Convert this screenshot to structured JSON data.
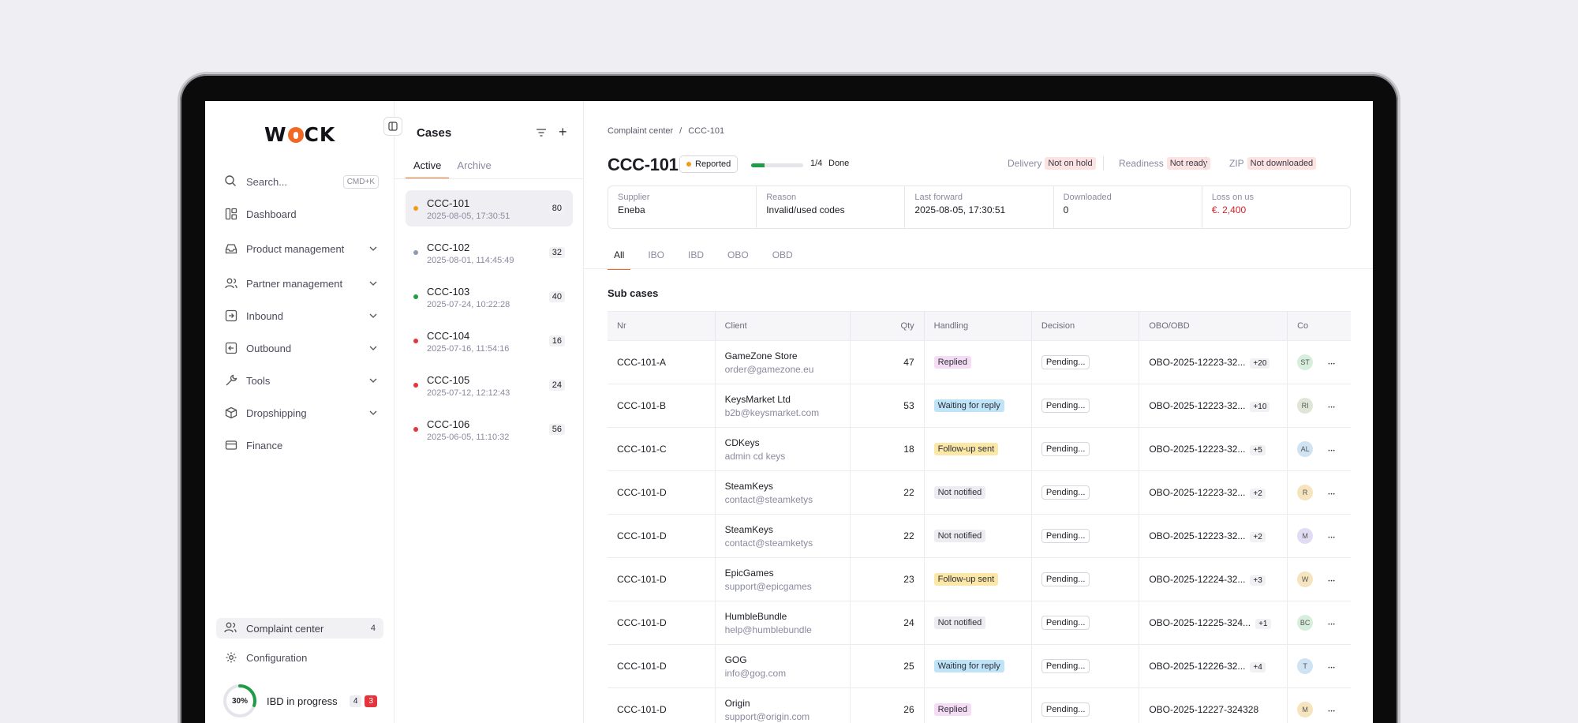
{
  "app": {
    "logo_left": "W",
    "logo_right": "CK"
  },
  "sidebar": {
    "search_label": "Search...",
    "search_shortcut": "CMD+K",
    "items": [
      {
        "label": "Dashboard",
        "icon": "dashboard-icon"
      },
      {
        "label": "Product management",
        "icon": "inbox-icon"
      },
      {
        "label": "Partner management",
        "icon": "users-icon"
      },
      {
        "label": "Inbound",
        "icon": "arrow-in-icon"
      },
      {
        "label": "Outbound",
        "icon": "arrow-out-icon"
      },
      {
        "label": "Tools",
        "icon": "wrench-icon"
      },
      {
        "label": "Dropshipping",
        "icon": "box-icon"
      },
      {
        "label": "Finance",
        "icon": "card-icon"
      }
    ],
    "complaint_center": {
      "label": "Complaint center",
      "count": "4"
    },
    "configuration": {
      "label": "Configuration"
    },
    "progress": {
      "percent_label": "30%",
      "percent": 0.3,
      "label": "IBD in progress",
      "count": "4",
      "alerts": "3"
    }
  },
  "cases": {
    "title": "Cases",
    "tabs": [
      "Active",
      "Archive"
    ],
    "items": [
      {
        "id": "CCC-101",
        "date": "2025-08-05, 17:30:51",
        "count": "80",
        "color": "#f29a1a"
      },
      {
        "id": "CCC-102",
        "date": "2025-08-01, 114:45:49",
        "count": "32",
        "color": "#8c9bb0"
      },
      {
        "id": "CCC-103",
        "date": "2025-07-24, 10:22:28",
        "count": "40",
        "color": "#1f9d46"
      },
      {
        "id": "CCC-104",
        "date": "2025-07-16, 11:54:16",
        "count": "16",
        "color": "#e5343b"
      },
      {
        "id": "CCC-105",
        "date": "2025-07-12, 12:12:43",
        "count": "24",
        "color": "#e5343b"
      },
      {
        "id": "CCC-106",
        "date": "2025-06-05, 11:10:32",
        "count": "56",
        "color": "#e5343b"
      }
    ]
  },
  "main": {
    "breadcrumb": [
      "Complaint center",
      "/",
      "CCC-101"
    ],
    "title": "CCC-101",
    "status": "Reported",
    "steps": {
      "text": "1/4",
      "done": "Done",
      "fraction": 0.25
    },
    "delivery": {
      "label": "Delivery",
      "value": "Not on hold"
    },
    "readiness": {
      "label": "Readiness",
      "value": "Not ready"
    },
    "zip": {
      "label": "ZIP",
      "value": "Not downloaded"
    },
    "info": [
      {
        "label": "Supplier",
        "value": "Eneba"
      },
      {
        "label": "Reason",
        "value": "Invalid/used codes"
      },
      {
        "label": "Last forward",
        "value": "2025-08-05, 17:30:51"
      },
      {
        "label": "Downloaded",
        "value": "0"
      },
      {
        "label": "Loss on us",
        "value": "€. 2,400"
      }
    ],
    "tabs": [
      "All",
      "IBO",
      "IBD",
      "OBO",
      "OBD"
    ],
    "sub_cases_title": "Sub cases",
    "columns": [
      "Nr",
      "Client",
      "Qty",
      "Handling",
      "Decision",
      "OBO/OBD",
      "Co"
    ],
    "rows": [
      {
        "nr": "CCC-101-A",
        "client": "GameZone Store",
        "email": "order@gamezone.eu",
        "qty": "47",
        "handling": "Replied",
        "decision": "Pending...",
        "obo": "OBO-2025-12223-32...",
        "plus": "+20",
        "avatar": "ST"
      },
      {
        "nr": "CCC-101-B",
        "client": "KeysMarket Ltd",
        "email": "b2b@keysmarket.com",
        "qty": "53",
        "handling": "Waiting for reply",
        "decision": "Pending...",
        "obo": "OBO-2025-12223-32...",
        "plus": "+10",
        "avatar": "RI"
      },
      {
        "nr": "CCC-101-C",
        "client": "CDKeys",
        "email": "admin cd keys",
        "qty": "18",
        "handling": "Follow-up sent",
        "decision": "Pending...",
        "obo": "OBO-2025-12223-32...",
        "plus": "+5",
        "avatar": "AL"
      },
      {
        "nr": "CCC-101-D",
        "client": "SteamKeys",
        "email": "contact@steamketys",
        "qty": "22",
        "handling": "Not notified",
        "decision": "Pending...",
        "obo": "OBO-2025-12223-32...",
        "plus": "+2",
        "avatar": "R"
      },
      {
        "nr": "CCC-101-D",
        "client": "SteamKeys",
        "email": "contact@steamketys",
        "qty": "22",
        "handling": "Not notified",
        "decision": "Pending...",
        "obo": "OBO-2025-12223-32...",
        "plus": "+2",
        "avatar": "M"
      },
      {
        "nr": "CCC-101-D",
        "client": "EpicGames",
        "email": "support@epicgames",
        "qty": "23",
        "handling": "Follow-up sent",
        "decision": "Pending...",
        "obo": "OBO-2025-12224-32...",
        "plus": "+3",
        "avatar": "W"
      },
      {
        "nr": "CCC-101-D",
        "client": "HumbleBundle",
        "email": "help@humblebundle",
        "qty": "24",
        "handling": "Not notified",
        "decision": "Pending...",
        "obo": "OBO-2025-12225-324...",
        "plus": "+1",
        "avatar": "BC"
      },
      {
        "nr": "CCC-101-D",
        "client": "GOG",
        "email": "info@gog.com",
        "qty": "25",
        "handling": "Waiting for reply",
        "decision": "Pending...",
        "obo": "OBO-2025-12226-32...",
        "plus": "+4",
        "avatar": "T"
      },
      {
        "nr": "CCC-101-D",
        "client": "Origin",
        "email": "support@origin.com",
        "qty": "26",
        "handling": "Replied",
        "decision": "Pending...",
        "obo": "OBO-2025-12227-324328",
        "plus": "",
        "avatar": "M"
      }
    ]
  },
  "colors": {
    "accent": "#f26722",
    "replied": "#f5dcf5",
    "waiting": "#bfe3f7",
    "followup": "#fbe7a6",
    "not_notified": "#ededf1"
  }
}
